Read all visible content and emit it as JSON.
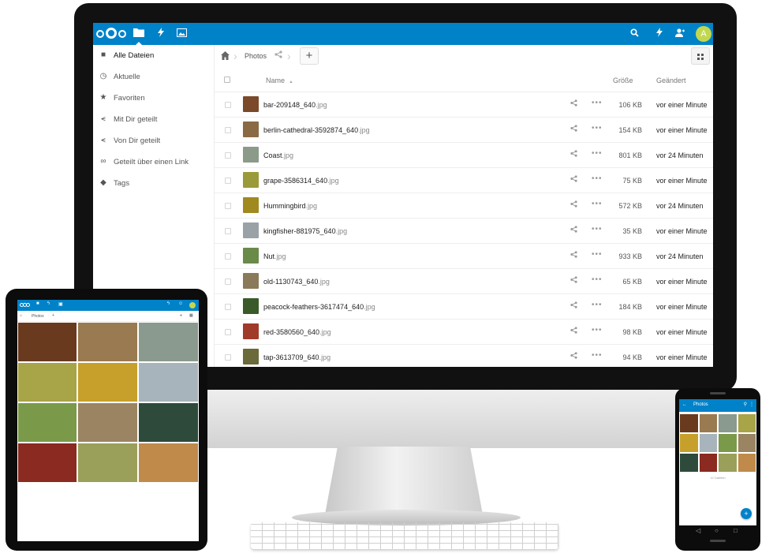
{
  "desktop": {
    "header_icons": [
      "logo-icon",
      "folder-icon",
      "activity-icon",
      "gallery-icon",
      "search-icon",
      "notifications-icon",
      "contacts-icon"
    ],
    "avatar": "A",
    "sidebar": [
      {
        "label": "Alle Dateien",
        "icon": "folder-icon",
        "glyph": "■",
        "active": true
      },
      {
        "label": "Aktuelle",
        "icon": "clock-icon",
        "glyph": "◷"
      },
      {
        "label": "Favoriten",
        "icon": "star-icon",
        "glyph": "★"
      },
      {
        "label": "Mit Dir geteilt",
        "icon": "share-icon",
        "glyph": "⪪"
      },
      {
        "label": "Von Dir geteilt",
        "icon": "share-icon",
        "glyph": "⪪"
      },
      {
        "label": "Geteilt über einen Link",
        "icon": "link-icon",
        "glyph": "∞"
      },
      {
        "label": "Tags",
        "icon": "tag-icon",
        "glyph": "◆"
      }
    ],
    "breadcrumb": {
      "folder": "Photos",
      "add": "+"
    },
    "table": {
      "headers": {
        "name": "Name",
        "sort_arrow": "▲",
        "size": "Größe",
        "modified": "Geändert"
      },
      "rows": [
        {
          "base": "bar-209148_640",
          "ext": ".jpg",
          "size": "106 KB",
          "modified": "vor einer Minute",
          "color": "#7a4a2a"
        },
        {
          "base": "berlin-cathedral-3592874_640",
          "ext": ".jpg",
          "size": "154 KB",
          "modified": "vor einer Minute",
          "color": "#8a6a44"
        },
        {
          "base": "Coast",
          "ext": ".jpg",
          "size": "801 KB",
          "modified": "vor 24 Minuten",
          "color": "#8c9a8a"
        },
        {
          "base": "grape-3586314_640",
          "ext": ".jpg",
          "size": "75 KB",
          "modified": "vor einer Minute",
          "color": "#9a9a3a"
        },
        {
          "base": "Hummingbird",
          "ext": ".jpg",
          "size": "572 KB",
          "modified": "vor 24 Minuten",
          "color": "#a08a20"
        },
        {
          "base": "kingfisher-881975_640",
          "ext": ".jpg",
          "size": "35 KB",
          "modified": "vor einer Minute",
          "color": "#9aa2a8"
        },
        {
          "base": "Nut",
          "ext": ".jpg",
          "size": "933 KB",
          "modified": "vor 24 Minuten",
          "color": "#6a8a4a"
        },
        {
          "base": "old-1130743_640",
          "ext": ".jpg",
          "size": "65 KB",
          "modified": "vor einer Minute",
          "color": "#8a7a5a"
        },
        {
          "base": "peacock-feathers-3617474_640",
          "ext": ".jpg",
          "size": "184 KB",
          "modified": "vor einer Minute",
          "color": "#3a5a2a"
        },
        {
          "base": "red-3580560_640",
          "ext": ".jpg",
          "size": "98 KB",
          "modified": "vor einer Minute",
          "color": "#a03a2a"
        },
        {
          "base": "tap-3613709_640",
          "ext": ".jpg",
          "size": "94 KB",
          "modified": "vor einer Minute",
          "color": "#6a6a3a"
        }
      ]
    }
  },
  "tablet": {
    "breadcrumb": "Photos",
    "tile_colors": [
      "#6a3a1e",
      "#9a7a50",
      "#8a9a8e",
      "#a8a448",
      "#c6a02a",
      "#a8b4bc",
      "#7a9a4a",
      "#9a8462",
      "#2e4a3a",
      "#8a2a20",
      "#9aa05a",
      "#c08a4a"
    ]
  },
  "phone": {
    "title": "Photos",
    "count": "12 Dateien",
    "fab": "+",
    "tile_colors": [
      "#6a3a1e",
      "#9a7a50",
      "#8a9a8e",
      "#a8a448",
      "#c6a02a",
      "#a8b4bc",
      "#7a9a4a",
      "#9a8462",
      "#2e4a3a",
      "#8a2a20",
      "#9aa05a",
      "#c08a4a"
    ]
  },
  "colors": {
    "brand": "#0082c9",
    "avatar": "#c1d84e"
  }
}
